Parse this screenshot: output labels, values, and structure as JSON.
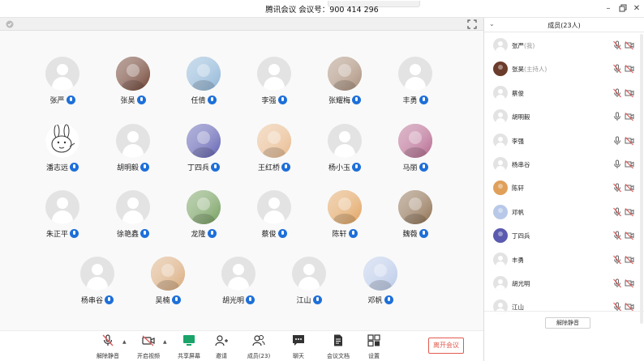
{
  "window": {
    "title": "腾讯会议  会议号：900 414 296"
  },
  "colors": {
    "accent": "#1e6fd9",
    "leave": "#e25a4f",
    "mute": "#e05a5a"
  },
  "gallery": {
    "participants": [
      {
        "name": "张严",
        "avatar": "default"
      },
      {
        "name": "张昊",
        "avatar": "photo",
        "tone": "#6b3b2b"
      },
      {
        "name": "任倩",
        "avatar": "photo",
        "tone": "#8bb3d6"
      },
      {
        "name": "李强",
        "avatar": "default"
      },
      {
        "name": "张耀梅",
        "avatar": "photo",
        "tone": "#a88b76"
      },
      {
        "name": "丰勇",
        "avatar": "default"
      },
      {
        "name": "潘志远",
        "avatar": "rabbit"
      },
      {
        "name": "胡明毅",
        "avatar": "default"
      },
      {
        "name": "丁四兵",
        "avatar": "photo",
        "tone": "#5a5ab0"
      },
      {
        "name": "王红桥",
        "avatar": "photo",
        "tone": "#e8b88a"
      },
      {
        "name": "杨小玉",
        "avatar": "default"
      },
      {
        "name": "马丽",
        "avatar": "photo",
        "tone": "#b4648c"
      },
      {
        "name": "朱正平",
        "avatar": "default"
      },
      {
        "name": "徐艳鑫",
        "avatar": "default"
      },
      {
        "name": "龙隆",
        "avatar": "photo",
        "tone": "#6f9b57"
      },
      {
        "name": "蔡俊",
        "avatar": "default"
      },
      {
        "name": "陈轩",
        "avatar": "photo",
        "tone": "#e0a05a"
      },
      {
        "name": "魏薇",
        "avatar": "photo",
        "tone": "#8a6a4a"
      },
      {
        "name": "杨串谷",
        "avatar": "default"
      },
      {
        "name": "吴楠",
        "avatar": "photo",
        "tone": "#d8a878"
      },
      {
        "name": "胡光明",
        "avatar": "default"
      },
      {
        "name": "江山",
        "avatar": "default"
      },
      {
        "name": "邓帆",
        "avatar": "photo",
        "tone": "#b8c8e8"
      }
    ]
  },
  "toolbar": {
    "unmute": "解除静音",
    "video": "开启视频",
    "share": "共享屏幕",
    "invite": "邀请",
    "members": "成员(23)",
    "chat": "聊天",
    "docs": "会议文档",
    "settings": "设置",
    "leave": "离开会议"
  },
  "panel": {
    "title": "成员(23人)",
    "unmute_all": "解除静音",
    "members": [
      {
        "name": "张严",
        "role": "(我)",
        "avatar": "default",
        "mic": "muted"
      },
      {
        "name": "张昊",
        "role": "(主持人)",
        "avatar": "photo",
        "tone": "#6b3b2b",
        "mic": "muted"
      },
      {
        "name": "蔡俊",
        "role": "",
        "avatar": "default",
        "mic": "muted"
      },
      {
        "name": "胡明毅",
        "role": "",
        "avatar": "default",
        "mic": "on"
      },
      {
        "name": "李强",
        "role": "",
        "avatar": "default",
        "mic": "on"
      },
      {
        "name": "杨串谷",
        "role": "",
        "avatar": "default",
        "mic": "on"
      },
      {
        "name": "陈轩",
        "role": "",
        "avatar": "photo",
        "tone": "#e0a05a",
        "mic": "muted"
      },
      {
        "name": "邓帆",
        "role": "",
        "avatar": "photo",
        "tone": "#b8c8e8",
        "mic": "muted"
      },
      {
        "name": "丁四兵",
        "role": "",
        "avatar": "photo",
        "tone": "#5a5ab0",
        "mic": "muted"
      },
      {
        "name": "丰勇",
        "role": "",
        "avatar": "default",
        "mic": "muted"
      },
      {
        "name": "胡光明",
        "role": "",
        "avatar": "default",
        "mic": "muted"
      },
      {
        "name": "江山",
        "role": "",
        "avatar": "default",
        "mic": "muted"
      }
    ]
  }
}
